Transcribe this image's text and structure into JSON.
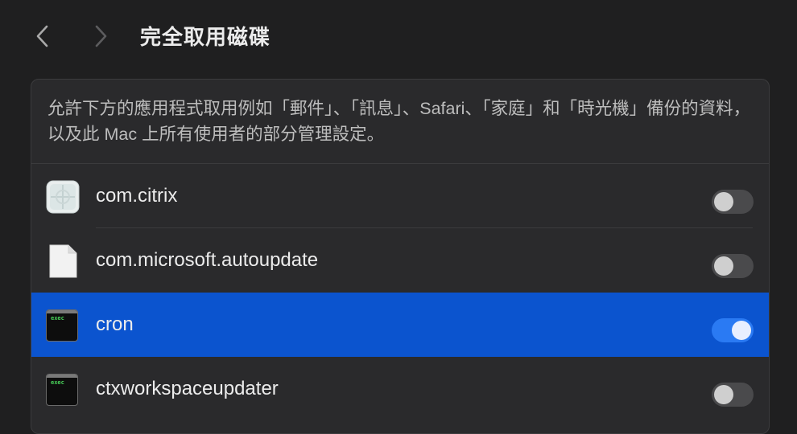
{
  "toolbar": {
    "back_icon": "chevron-left-icon",
    "forward_icon": "chevron-right-icon",
    "title": "完全取用磁碟"
  },
  "panel": {
    "description": "允許下方的應用程式取用例如「郵件」、「訊息」、Safari、「家庭」和「時光機」備份的資料，以及此 Mac 上所有使用者的部分管理設定。",
    "items": [
      {
        "label": "com.citrix",
        "icon": "citrix-app-icon",
        "enabled": false,
        "selected": false
      },
      {
        "label": "com.microsoft.autoupdate",
        "icon": "document-icon",
        "enabled": false,
        "selected": false
      },
      {
        "label": "cron",
        "icon": "terminal-exec-icon",
        "icon_text": "exec",
        "enabled": true,
        "selected": true
      },
      {
        "label": "ctxworkspaceupdater",
        "icon": "terminal-exec-icon",
        "icon_text": "exec",
        "enabled": false,
        "selected": false
      }
    ]
  },
  "colors": {
    "background": "#1f1f20",
    "panel": "#2a2a2c",
    "selection": "#0b54cf",
    "toggle_on": "#2a7af3",
    "toggle_off": "#4a4a4c",
    "terminal_text": "#49d35a"
  }
}
